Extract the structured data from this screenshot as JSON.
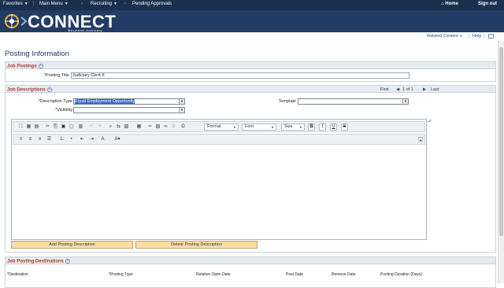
{
  "topnav": {
    "favorites": "Favorites",
    "main_menu": "Main Menu",
    "recruiting": "Recruiting",
    "pending_approvals": "Pending Approvals",
    "home": "Home",
    "sign_out": "Sign out"
  },
  "brand": {
    "name": "CONNECT",
    "sub": "Maryland Judiciary"
  },
  "context": {
    "related_content": "Related Content",
    "help": "Help"
  },
  "page": {
    "title": "Posting Information"
  },
  "job_postings": {
    "title": "Job Postings",
    "posting_title_label": "*Posting Title",
    "posting_title_value": "Judiciary Clerk II"
  },
  "job_descriptions": {
    "title": "Job Descriptions",
    "nav": {
      "first": "First",
      "count": "1 of 1",
      "last": "Last"
    },
    "description_type_label": "*Description Type",
    "description_type_value": "Equal Employment Opportunity",
    "visibility_label": "*Visibility",
    "visibility_value": "",
    "template_label": "Template",
    "template_value": ""
  },
  "editor": {
    "format": "Format",
    "font": "Font",
    "size": "Size",
    "bold": "B",
    "italic": "I",
    "underline": "U",
    "strike": "S"
  },
  "buttons": {
    "add": "Add Posting Description",
    "delete": "Delete Posting Description"
  },
  "destinations": {
    "title": "Job Posting Destinations",
    "headers": [
      "*Destination",
      "*Posting Type",
      "Relative Open Date",
      "Post Date",
      "Remove Date",
      "Posting Duration (Days)"
    ]
  }
}
